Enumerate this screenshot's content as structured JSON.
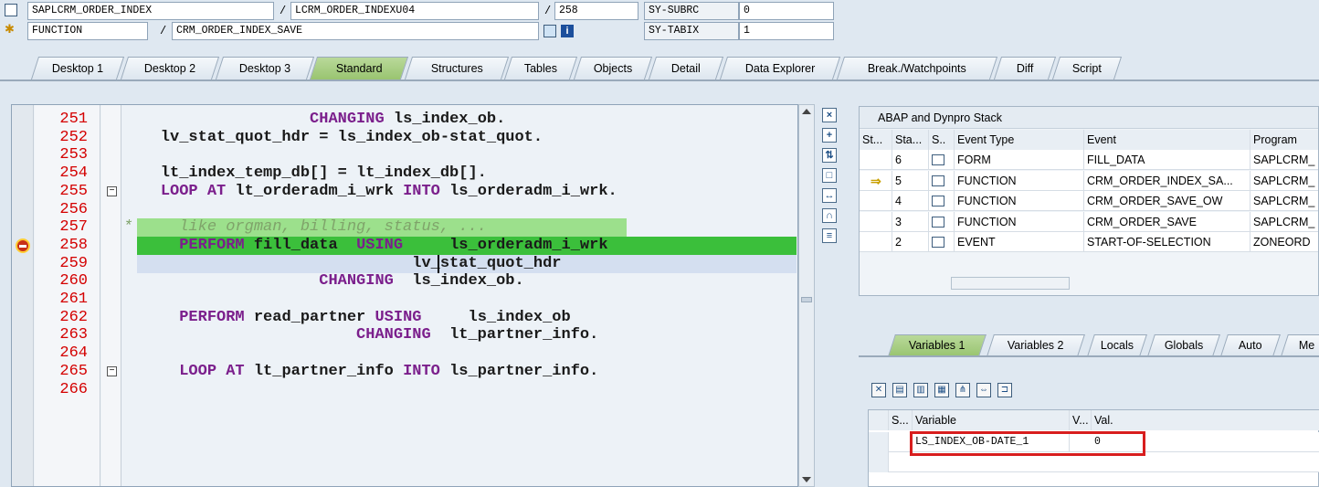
{
  "info": {
    "row1": {
      "program": "SAPLCRM_ORDER_INDEX",
      "include": "LCRM_ORDER_INDEXU04",
      "line": "258",
      "sysvar": "SY-SUBRC",
      "sysval": "0"
    },
    "row2": {
      "type": "FUNCTION",
      "name": "CRM_ORDER_INDEX_SAVE",
      "sysvar": "SY-TABIX",
      "sysval": "1"
    },
    "sep": "/"
  },
  "tabs": [
    "Desktop 1",
    "Desktop 2",
    "Desktop 3",
    "Standard",
    "Structures",
    "Tables",
    "Objects",
    "Detail",
    "Data Explorer",
    "Break./Watchpoints",
    "Diff",
    "Script"
  ],
  "active_tab": "Standard",
  "code": {
    "lines": [
      {
        "num": "251",
        "segments": [
          {
            "t": "                    ",
            "c": "plain"
          },
          {
            "t": "CHANGING",
            "c": "kw"
          },
          {
            "t": " ls_index_ob.",
            "c": "plain"
          }
        ]
      },
      {
        "num": "252",
        "segments": [
          {
            "t": "    lv_stat_quot_hdr = ls_index_ob-stat_quot.",
            "c": "plain"
          }
        ]
      },
      {
        "num": "253",
        "segments": []
      },
      {
        "num": "254",
        "segments": [
          {
            "t": "    lt_index_temp_db[] = lt_index_db[].",
            "c": "plain"
          }
        ]
      },
      {
        "num": "255",
        "segments": [
          {
            "t": "    ",
            "c": "plain"
          },
          {
            "t": "LOOP AT",
            "c": "kw"
          },
          {
            "t": " lt_orderadm_i_wrk ",
            "c": "plain"
          },
          {
            "t": "INTO",
            "c": "kw"
          },
          {
            "t": " ls_orderadm_i_wrk.",
            "c": "plain"
          }
        ]
      },
      {
        "num": "256",
        "segments": []
      },
      {
        "num": "257",
        "segments": [
          {
            "t": "*     like orgman, billing, status, ...",
            "c": "cmt"
          }
        ]
      },
      {
        "num": "258",
        "segments": [
          {
            "t": "      ",
            "c": "plain"
          },
          {
            "t": "PERFORM",
            "c": "kw"
          },
          {
            "t": " fill_data  ",
            "c": "plain"
          },
          {
            "t": "USING",
            "c": "kw"
          },
          {
            "t": "     ls_orderadm_i_wrk",
            "c": "plain"
          }
        ]
      },
      {
        "num": "259",
        "segments": [
          {
            "t": "                               lv_stat_quot_hdr",
            "c": "plain"
          }
        ]
      },
      {
        "num": "260",
        "segments": [
          {
            "t": "                     ",
            "c": "plain"
          },
          {
            "t": "CHANGING",
            "c": "kw"
          },
          {
            "t": "  ls_index_ob.",
            "c": "plain"
          }
        ]
      },
      {
        "num": "261",
        "segments": []
      },
      {
        "num": "262",
        "segments": [
          {
            "t": "      ",
            "c": "plain"
          },
          {
            "t": "PERFORM",
            "c": "kw"
          },
          {
            "t": " read_partner ",
            "c": "plain"
          },
          {
            "t": "USING",
            "c": "kw"
          },
          {
            "t": "     ls_index_ob",
            "c": "plain"
          }
        ]
      },
      {
        "num": "263",
        "segments": [
          {
            "t": "                         ",
            "c": "plain"
          },
          {
            "t": "CHANGING",
            "c": "kw"
          },
          {
            "t": "  lt_partner_info.",
            "c": "plain"
          }
        ]
      },
      {
        "num": "264",
        "segments": []
      },
      {
        "num": "265",
        "segments": [
          {
            "t": "      ",
            "c": "plain"
          },
          {
            "t": "LOOP AT",
            "c": "kw"
          },
          {
            "t": " lt_partner_info ",
            "c": "plain"
          },
          {
            "t": "INTO",
            "c": "kw"
          },
          {
            "t": " ls_partner_info.",
            "c": "plain"
          }
        ]
      },
      {
        "num": "266",
        "segments": []
      }
    ]
  },
  "stack": {
    "title": "ABAP and Dynpro Stack",
    "headers": [
      "St...",
      "Sta...",
      "S..",
      "Event Type",
      "Event",
      "Program"
    ],
    "rows": [
      {
        "st": "",
        "sta": "6",
        "type": "FORM",
        "event": "FILL_DATA",
        "program": "SAPLCRM_"
      },
      {
        "st": "⇒",
        "sta": "5",
        "type": "FUNCTION",
        "event": "CRM_ORDER_INDEX_SA...",
        "program": "SAPLCRM_"
      },
      {
        "st": "",
        "sta": "4",
        "type": "FUNCTION",
        "event": "CRM_ORDER_SAVE_OW",
        "program": "SAPLCRM_"
      },
      {
        "st": "",
        "sta": "3",
        "type": "FUNCTION",
        "event": "CRM_ORDER_SAVE",
        "program": "SAPLCRM_"
      },
      {
        "st": "",
        "sta": "2",
        "type": "EVENT",
        "event": "START-OF-SELECTION",
        "program": "ZONEORD"
      }
    ]
  },
  "vars": {
    "tabs": [
      "Variables 1",
      "Variables 2",
      "Locals",
      "Globals",
      "Auto",
      "Me"
    ],
    "active_tab": "Variables 1",
    "headers": [
      "S...",
      "Variable",
      "V...",
      "Val."
    ],
    "rows": [
      {
        "variable": "LS_INDEX_OB-DATE_1",
        "value": "0"
      }
    ]
  }
}
